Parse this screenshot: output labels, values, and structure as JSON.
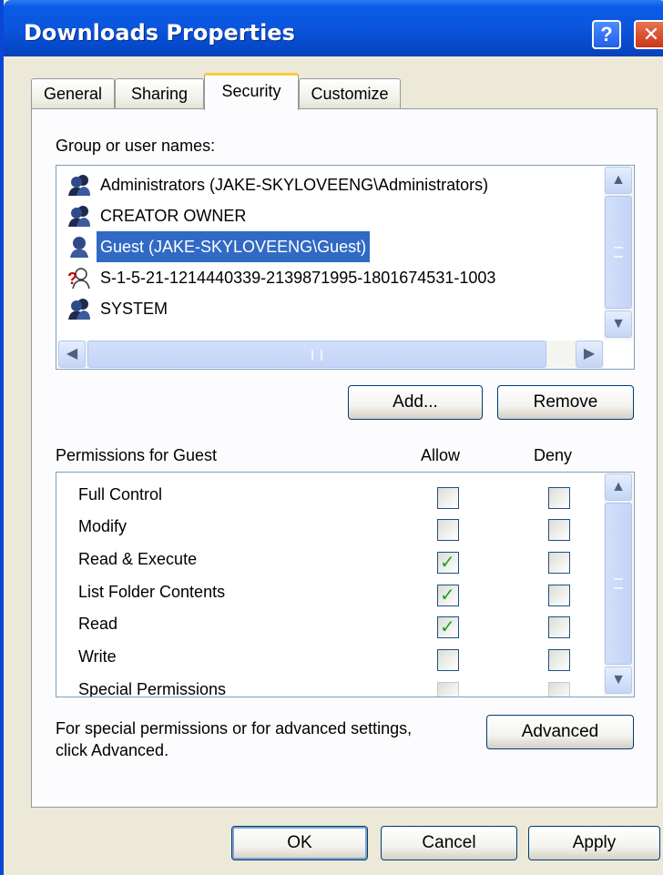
{
  "window": {
    "title": "Downloads Properties",
    "help_label": "?",
    "close_label": "✕"
  },
  "tabs": [
    {
      "label": "General"
    },
    {
      "label": "Sharing"
    },
    {
      "label": "Security"
    },
    {
      "label": "Customize"
    }
  ],
  "groups": {
    "label": "Group or user names:",
    "items": [
      {
        "label": "Administrators (JAKE-SKYLOVEENG\\Administrators)",
        "icon": "group-icon"
      },
      {
        "label": "CREATOR OWNER",
        "icon": "group-icon"
      },
      {
        "label": "Guest (JAKE-SKYLOVEENG\\Guest)",
        "icon": "user-icon",
        "selected": true
      },
      {
        "label": "S-1-5-21-1214440339-2139871995-1801674531-1003",
        "icon": "unknown-user-icon"
      },
      {
        "label": "SYSTEM",
        "icon": "group-icon"
      }
    ],
    "add_label": "Add...",
    "remove_label": "Remove"
  },
  "permissions": {
    "title": "Permissions for Guest",
    "allow_header": "Allow",
    "deny_header": "Deny",
    "rows": [
      {
        "name": "Full Control",
        "allow": false,
        "deny": false
      },
      {
        "name": "Modify",
        "allow": false,
        "deny": false
      },
      {
        "name": "Read & Execute",
        "allow": true,
        "deny": false
      },
      {
        "name": "List Folder Contents",
        "allow": true,
        "deny": false
      },
      {
        "name": "Read",
        "allow": true,
        "deny": false
      },
      {
        "name": "Write",
        "allow": false,
        "deny": false
      },
      {
        "name": "Special Permissions",
        "allow": false,
        "deny": false
      }
    ]
  },
  "advanced": {
    "note_line1": "For special permissions or for advanced settings,",
    "note_line2": "click Advanced.",
    "button_label": "Advanced"
  },
  "footer": {
    "ok_label": "OK",
    "cancel_label": "Cancel",
    "apply_label": "Apply"
  },
  "colors": {
    "titlebar": "#0a55dc",
    "selection": "#316ac5",
    "dialog_bg": "#ece9d8",
    "check": "#21a121",
    "active_tab_accent": "#ffc83c"
  }
}
